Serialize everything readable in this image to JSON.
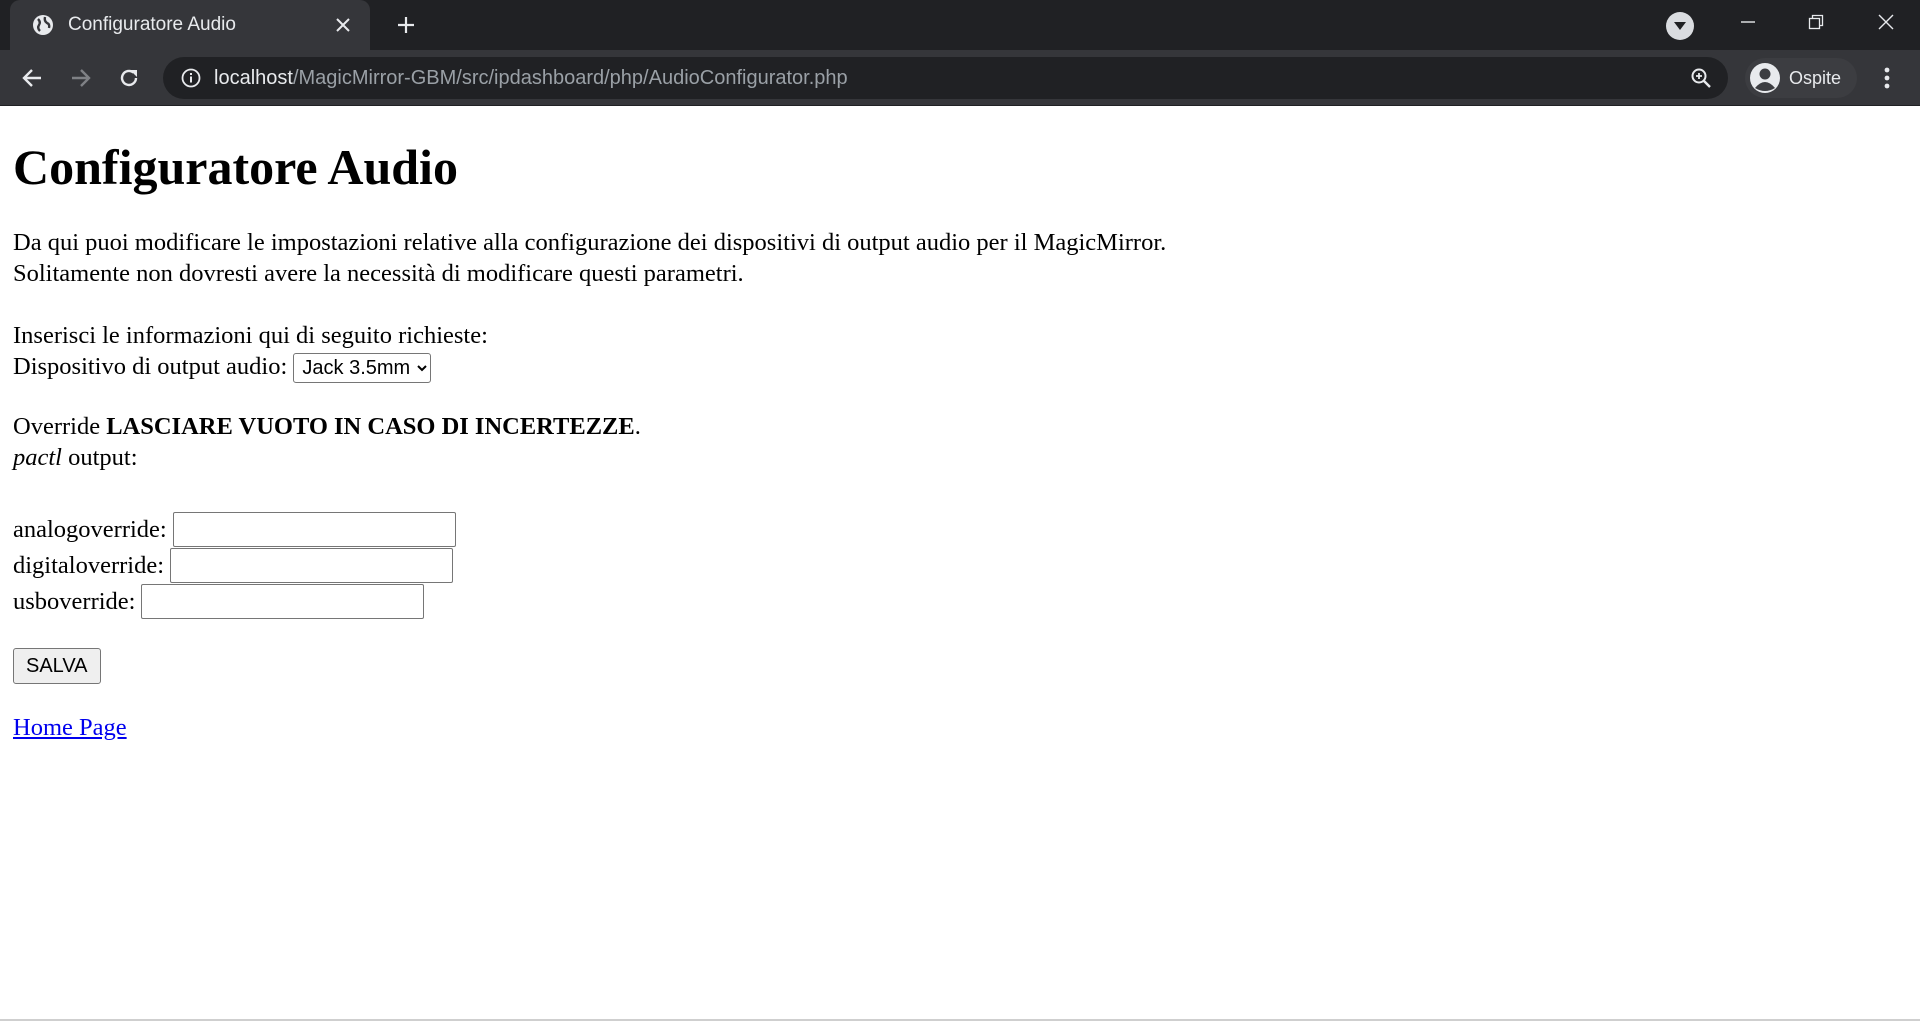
{
  "browser": {
    "tab_title": "Configuratore Audio",
    "url_host": "localhost",
    "url_path": "/MagicMirror-GBM/src/ipdashboard/php/AudioConfigurator.php",
    "profile_name": "Ospite"
  },
  "page": {
    "title": "Configuratore Audio",
    "intro_line1": "Da qui puoi modificare le impostazioni relative alla configurazione dei dispositivi di output audio per il MagicMirror.",
    "intro_line2": "Solitamente non dovresti avere la necessità di modificare questi parametri.",
    "prompt": "Inserisci le informazioni qui di seguito richieste:",
    "device_label": "Dispositivo di output audio:",
    "device_selected": "Jack 3.5mm",
    "override_prefix": "Override ",
    "override_warning": "LASCIARE VUOTO IN CASO DI INCERTEZZE",
    "override_suffix": ".",
    "pactl_cmd": "pactl",
    "pactl_suffix": " output:",
    "analog_label": "analogoverride:",
    "analog_value": "",
    "digital_label": "digitaloverride:",
    "digital_value": "",
    "usb_label": "usboverride:",
    "usb_value": "",
    "save_label": "SALVA",
    "home_link": "Home Page"
  },
  "icons": {
    "favicon": "globe-icon",
    "close": "close-icon",
    "new_tab": "plus-icon",
    "tab_search": "chevron-down-icon",
    "back": "back-arrow-icon",
    "forward": "forward-arrow-icon",
    "reload": "reload-icon",
    "info": "info-icon",
    "zoom": "zoom-icon",
    "avatar": "avatar-icon",
    "menu": "kebab-menu-icon"
  },
  "colors": {
    "chrome_dark": "#202124",
    "chrome_tab": "#35363a",
    "link": "#0000ee"
  }
}
